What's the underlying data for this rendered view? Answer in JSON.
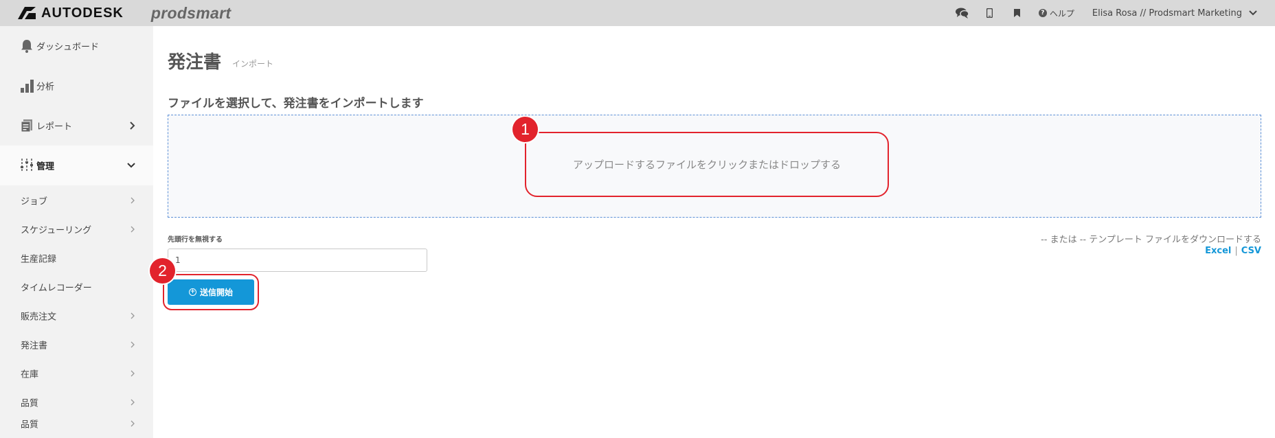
{
  "topbar": {
    "brand": "AUTODESK",
    "product": "prodsmart",
    "help_label": "ヘルプ",
    "user_label": "Elisa Rosa // Prodsmart Marketing",
    "icons": [
      "chat-icon",
      "mobile-icon",
      "bookmark-icon",
      "help-icon",
      "chevron-down-icon"
    ]
  },
  "sidebar": {
    "items": [
      {
        "label": "ダッシュボード",
        "icon": "bell-icon"
      },
      {
        "label": "分析",
        "icon": "bar-chart-icon"
      },
      {
        "label": "レポート",
        "icon": "report-icon"
      },
      {
        "label": "管理",
        "icon": "sliders-icon"
      }
    ],
    "sub_items": [
      {
        "label": "ジョブ"
      },
      {
        "label": "スケジューリング"
      },
      {
        "label": "生産記録"
      },
      {
        "label": "タイムレコーダー"
      },
      {
        "label": "販売注文"
      },
      {
        "label": "発注書"
      },
      {
        "label": "在庫"
      },
      {
        "label": "品質"
      },
      {
        "label": "品質"
      }
    ]
  },
  "page": {
    "title": "発注書",
    "subtitle": "インポート",
    "section_title": "ファイルを選択して、発注書をインポートします"
  },
  "upload": {
    "text": "アップロードするファイルをクリックまたはドロップする"
  },
  "form": {
    "skip_rows_label": "先頭行を無視する",
    "skip_rows_value": "1"
  },
  "import_button": {
    "label": "送信開始"
  },
  "template": {
    "text": "-- または -- テンプレート ファイルをダウンロードする",
    "excel": "Excel",
    "separator": "|",
    "csv": "CSV"
  },
  "markers": {
    "one": "1",
    "two": "2"
  },
  "colors": {
    "accent": "#1497d8",
    "highlight": "#e2232c",
    "topbar": "#d9d9d9",
    "sidebar": "#f2f2f2"
  }
}
